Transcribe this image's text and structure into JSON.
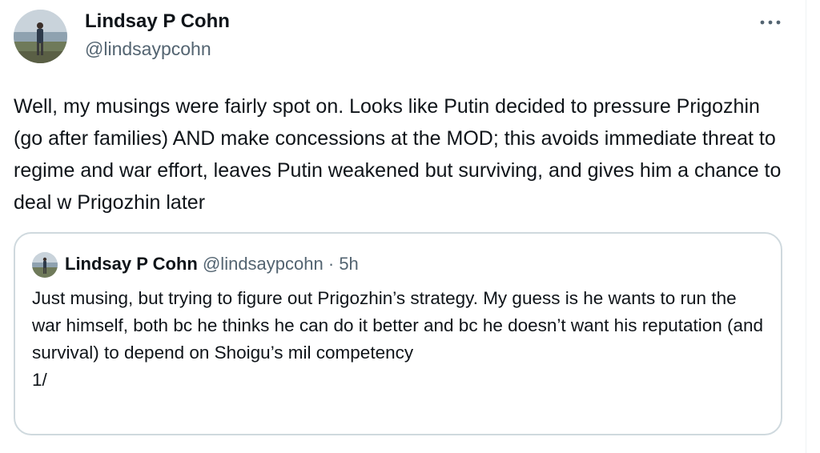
{
  "tweet": {
    "author": {
      "name": "Lindsay P Cohn",
      "handle": "@lindsaypcohn"
    },
    "text": "Well, my musings were fairly spot on. Looks like Putin decided to pressure Prigozhin (go after families) AND make concessions at the MOD; this avoids immediate threat to regime and war effort, leaves Putin weakened but surviving, and gives him a chance to deal w Prigozhin later",
    "more_icon": "ellipsis-icon"
  },
  "quoted_tweet": {
    "author": {
      "name": "Lindsay P Cohn",
      "handle": "@lindsaypcohn",
      "separator": "·",
      "time": "5h"
    },
    "text_lines": [
      "Just musing, but trying to figure out Prigozhin’s strategy. My guess is he wants to run the war himself, both bc he thinks he can do it better and bc he doesn’t want his reputation (and survival) to depend on Shoigu’s mil competency",
      "1/"
    ]
  },
  "colors": {
    "text": "#0f1419",
    "secondary": "#536471",
    "border": "#cfd9de"
  }
}
